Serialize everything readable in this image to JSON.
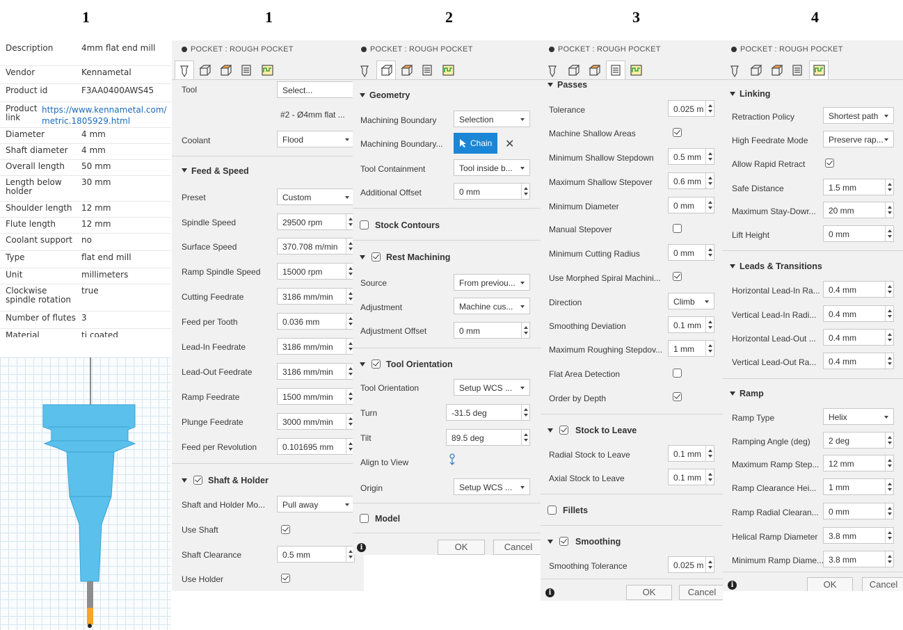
{
  "headings": [
    "1",
    "1",
    "2",
    "3",
    "4"
  ],
  "tool_info": [
    {
      "k": "Description",
      "v": "4mm flat end mill"
    },
    {
      "k": "Vendor",
      "v": "Kennametal"
    },
    {
      "k": "Product id",
      "v": "F3AA0400AWS45"
    },
    {
      "k": "Product link",
      "v": "https://www.kennametal.com/metric.1805929.html"
    },
    {
      "k": "Diameter",
      "v": "4 mm"
    },
    {
      "k": "Shaft diameter",
      "v": "4 mm"
    },
    {
      "k": "Overall length",
      "v": "50 mm"
    },
    {
      "k": "Length below holder",
      "v": "30 mm"
    },
    {
      "k": "Shoulder length",
      "v": "12 mm"
    },
    {
      "k": "Flute length",
      "v": "12 mm"
    },
    {
      "k": "Coolant support",
      "v": "no"
    },
    {
      "k": "Type",
      "v": "flat end mill"
    },
    {
      "k": "Unit",
      "v": "millimeters"
    },
    {
      "k": "Clockwise spindle rotation",
      "v": "true"
    },
    {
      "k": "Number of flutes",
      "v": "3"
    },
    {
      "k": "Material",
      "v": "ti coated"
    }
  ],
  "panel_title": "POCKET : ROUGH POCKET",
  "tab_icons": [
    "tool-tab-icon",
    "geometry-tab-icon",
    "heights-tab-icon",
    "passes-tab-icon",
    "linking-tab-icon"
  ],
  "p1": {
    "tool_label": "Tool",
    "tool_btn": "Select...",
    "tool_name": "#2 - Ø4mm flat ...",
    "coolant_label": "Coolant",
    "coolant": "Flood",
    "feed_section": "Feed & Speed",
    "preset_label": "Preset",
    "preset": "Custom",
    "spindle_label": "Spindle Speed",
    "spindle": "29500 rpm",
    "surface_label": "Surface Speed",
    "surface": "370.708 m/min",
    "ramp_spindle_label": "Ramp Spindle Speed",
    "ramp_spindle": "15000 rpm",
    "cutting_label": "Cutting Feedrate",
    "cutting": "3186 mm/min",
    "fpt_label": "Feed per Tooth",
    "fpt": "0.036 mm",
    "leadin_label": "Lead-In Feedrate",
    "leadin": "3186 mm/min",
    "leadout_label": "Lead-Out Feedrate",
    "leadout": "3186 mm/min",
    "ramp_label": "Ramp Feedrate",
    "ramp": "1500 mm/min",
    "plunge_label": "Plunge Feedrate",
    "plunge": "3000 mm/min",
    "fpr_label": "Feed per Revolution",
    "fpr": "0.101695 mm",
    "shaft_section": "Shaft & Holder",
    "shaft_mode_label": "Shaft and Holder Mo...",
    "shaft_mode": "Pull away",
    "use_shaft_label": "Use Shaft",
    "shaft_clear_label": "Shaft Clearance",
    "shaft_clear": "0.5 mm",
    "use_holder_label": "Use Holder"
  },
  "p2": {
    "geometry_section": "Geometry",
    "mb_label": "Machining Boundary",
    "mb": "Selection",
    "mb2_label": "Machining Boundary...",
    "chain": "Chain",
    "tc_label": "Tool Containment",
    "tc": "Tool inside b...",
    "ao_label": "Additional Offset",
    "ao": "0 mm",
    "stock_section": "Stock Contours",
    "rest_section": "Rest Machining",
    "source_label": "Source",
    "source": "From previou...",
    "adj_label": "Adjustment",
    "adj": "Machine cus...",
    "adjoff_label": "Adjustment Offset",
    "adjoff": "0 mm",
    "orient_section": "Tool Orientation",
    "to_label": "Tool Orientation",
    "to": "Setup WCS ...",
    "turn_label": "Turn",
    "turn": "-31.5 deg",
    "tilt_label": "Tilt",
    "tilt": "89.5 deg",
    "align_label": "Align to View",
    "origin_label": "Origin",
    "origin": "Setup WCS ...",
    "model_section": "Model",
    "ok": "OK",
    "cancel": "Cancel"
  },
  "p3": {
    "passes_section": "Passes",
    "tol_label": "Tolerance",
    "tol": "0.025 m",
    "msa_label": "Machine Shallow Areas",
    "msd_label": "Minimum Shallow Stepdown",
    "msd": "0.5 mm",
    "mss_label": "Maximum Shallow Stepover",
    "mss": "0.6 mm",
    "md_label": "Minimum Diameter",
    "md": "0 mm",
    "mso_label": "Manual Stepover",
    "mcr_label": "Minimum Cutting Radius",
    "mcr": "0 mm",
    "ums_label": "Use Morphed Spiral Machini...",
    "dir_label": "Direction",
    "dir": "Climb",
    "sd_label": "Smoothing Deviation",
    "sd": "0.1 mm",
    "mrs_label": "Maximum Roughing Stepdov...",
    "mrs": "1 mm",
    "fad_label": "Flat Area Detection",
    "obd_label": "Order by Depth",
    "stl_section": "Stock to Leave",
    "rsl_label": "Radial Stock to Leave",
    "rsl": "0.1 mm",
    "asl_label": "Axial Stock to Leave",
    "asl": "0.1 mm",
    "fillets_section": "Fillets",
    "smooth_section": "Smoothing",
    "st_label": "Smoothing Tolerance",
    "st": "0.025 m",
    "ok": "OK",
    "cancel": "Cancel"
  },
  "p4": {
    "linking_section": "Linking",
    "rp_label": "Retraction Policy",
    "rp": "Shortest path",
    "hfm_label": "High Feedrate Mode",
    "hfm": "Preserve rap...",
    "arr_label": "Allow Rapid Retract",
    "sdist_label": "Safe Distance",
    "sdist": "1.5 mm",
    "msdown_label": "Maximum Stay-Dowr...",
    "msdown": "20 mm",
    "lh_label": "Lift Height",
    "lh": "0 mm",
    "leads_section": "Leads & Transitions",
    "hli_label": "Horizontal Lead-In Ra...",
    "hli": "0.4 mm",
    "vli_label": "Vertical Lead-In Radi...",
    "vli": "0.4 mm",
    "hlo_label": "Horizontal Lead-Out ...",
    "hlo": "0.4 mm",
    "vlo_label": "Vertical Lead-Out Ra...",
    "vlo": "0.4 mm",
    "ramp_section": "Ramp",
    "rt_label": "Ramp Type",
    "rt": "Helix",
    "ra_label": "Ramping Angle (deg)",
    "ra": "2 deg",
    "mrst_label": "Maximum Ramp Step...",
    "mrst": "12 mm",
    "rch_label": "Ramp Clearance Hei...",
    "rch": "1 mm",
    "rrc_label": "Ramp Radial Clearan...",
    "rrc": "0 mm",
    "hrd_label": "Helical Ramp Diameter",
    "hrd": "3.8 mm",
    "mrd_label": "Minimum Ramp Diame...",
    "mrd": "3.8 mm",
    "ok": "OK",
    "cancel": "Cancel"
  },
  "colors": {
    "tool_body": "#5bc0ec",
    "chain_button": "#1b86d6",
    "tool_tip": "#f5a623"
  }
}
